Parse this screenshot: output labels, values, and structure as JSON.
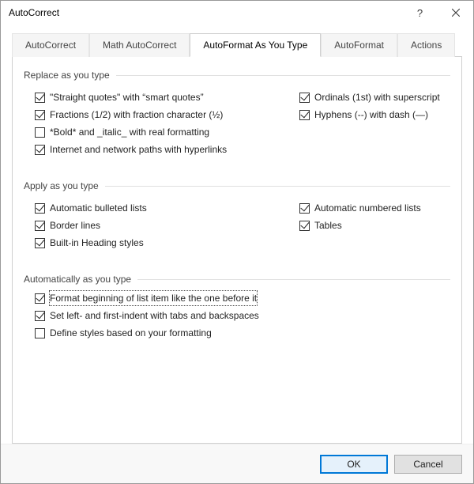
{
  "window": {
    "title": "AutoCorrect"
  },
  "tabs": {
    "items": [
      {
        "label": "AutoCorrect"
      },
      {
        "label": "Math AutoCorrect"
      },
      {
        "label": "AutoFormat As You Type"
      },
      {
        "label": "AutoFormat"
      },
      {
        "label": "Actions"
      }
    ],
    "active_index": 2
  },
  "groups": {
    "replace": {
      "title": "Replace as you type",
      "left": [
        {
          "label": "\"Straight quotes\" with “smart quotes”",
          "checked": true
        },
        {
          "label": "Fractions (1/2) with fraction character (½)",
          "checked": true
        },
        {
          "label": "*Bold* and _italic_ with real formatting",
          "checked": false
        },
        {
          "label": "Internet and network paths with hyperlinks",
          "checked": true
        }
      ],
      "right": [
        {
          "label": "Ordinals (1st) with superscript",
          "checked": true
        },
        {
          "label": "Hyphens (--) with dash (—)",
          "checked": true
        }
      ]
    },
    "apply": {
      "title": "Apply as you type",
      "left": [
        {
          "label": "Automatic bulleted lists",
          "checked": true
        },
        {
          "label": "Border lines",
          "checked": true
        },
        {
          "label": "Built-in Heading styles",
          "checked": true
        }
      ],
      "right": [
        {
          "label": "Automatic numbered lists",
          "checked": true
        },
        {
          "label": "Tables",
          "checked": true
        }
      ]
    },
    "auto": {
      "title": "Automatically as you type",
      "items": [
        {
          "label": "Format beginning of list item like the one before it",
          "checked": true,
          "focused": true
        },
        {
          "label": "Set left- and first-indent with tabs and backspaces",
          "checked": true
        },
        {
          "label": "Define styles based on your formatting",
          "checked": false
        }
      ]
    }
  },
  "buttons": {
    "ok": "OK",
    "cancel": "Cancel"
  }
}
